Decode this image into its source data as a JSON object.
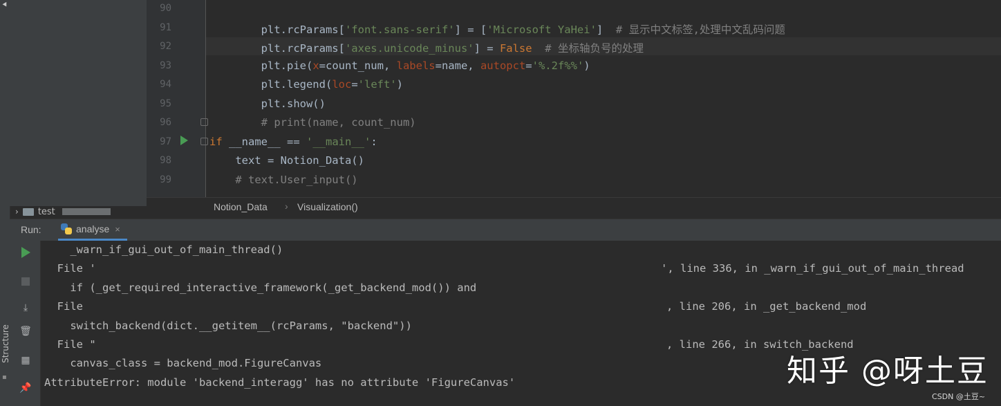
{
  "left_strip": {
    "label": "Structure",
    "top_glyph": "⯇"
  },
  "project": {
    "folder": "test"
  },
  "editor": {
    "lines": [
      {
        "no": "90",
        "segments": []
      },
      {
        "no": "91",
        "segments": [
          {
            "t": "        plt.rcParams[",
            "c": "k-fn"
          },
          {
            "t": "'font.sans-serif'",
            "c": "k-str"
          },
          {
            "t": "] = [",
            "c": "k-fn"
          },
          {
            "t": "'Microsoft YaHei'",
            "c": "k-str"
          },
          {
            "t": "]  ",
            "c": "k-fn"
          },
          {
            "t": "# 显示中文标签,处理中文乱码问题",
            "c": "k-com"
          }
        ]
      },
      {
        "no": "92",
        "segments": [
          {
            "t": "        plt.rcParams[",
            "c": "k-fn"
          },
          {
            "t": "'axes.unicode_minus'",
            "c": "k-str"
          },
          {
            "t": "] = ",
            "c": "k-fn"
          },
          {
            "t": "False",
            "c": "k-kw"
          },
          {
            "t": "  ",
            "c": "k-fn"
          },
          {
            "t": "# 坐标轴负号的处理",
            "c": "k-com"
          }
        ]
      },
      {
        "no": "93",
        "segments": [
          {
            "t": "        plt.pie(",
            "c": "k-fn"
          },
          {
            "t": "x",
            "c": "k-param"
          },
          {
            "t": "=count_num, ",
            "c": "k-fn"
          },
          {
            "t": "labels",
            "c": "k-param"
          },
          {
            "t": "=name, ",
            "c": "k-fn"
          },
          {
            "t": "autopct",
            "c": "k-param"
          },
          {
            "t": "=",
            "c": "k-fn"
          },
          {
            "t": "'%.2f%%'",
            "c": "k-str"
          },
          {
            "t": ")",
            "c": "k-fn"
          }
        ]
      },
      {
        "no": "94",
        "segments": [
          {
            "t": "        plt.legend(",
            "c": "k-fn"
          },
          {
            "t": "loc",
            "c": "k-param"
          },
          {
            "t": "=",
            "c": "k-fn"
          },
          {
            "t": "'left'",
            "c": "k-str"
          },
          {
            "t": ")",
            "c": "k-fn"
          }
        ]
      },
      {
        "no": "95",
        "segments": [
          {
            "t": "        plt.show()",
            "c": "k-fn"
          }
        ]
      },
      {
        "no": "96",
        "segments": [
          {
            "t": "        # print(name, count_num)",
            "c": "k-com"
          }
        ]
      },
      {
        "no": "97",
        "segments": [
          {
            "t": "if",
            "c": "k-kw"
          },
          {
            "t": " __name__ == ",
            "c": "k-fn"
          },
          {
            "t": "'__main__'",
            "c": "k-str"
          },
          {
            "t": ":",
            "c": "k-fn"
          }
        ]
      },
      {
        "no": "98",
        "segments": [
          {
            "t": "    text = Notion_Data()",
            "c": "k-fn"
          }
        ]
      },
      {
        "no": "99",
        "segments": [
          {
            "t": "    # text.User_input()",
            "c": "k-com"
          }
        ]
      }
    ]
  },
  "breadcrumb": {
    "items": [
      "Notion_Data",
      "Visualization()"
    ],
    "separator": "›"
  },
  "run": {
    "label": "Run:",
    "tab_label": "analyse",
    "close_glyph": "×"
  },
  "console": {
    "lines": [
      {
        "text": "    _warn_if_gui_out_of_main_thread()"
      },
      {
        "text": "  File '",
        "tail": "', line 336, in _warn_if_gui_out_of_main_thread"
      },
      {
        "text": "    if (_get_required_interactive_framework(_get_backend_mod()) and"
      },
      {
        "text": "  File",
        "tail": ", line 206, in _get_backend_mod"
      },
      {
        "text": "    switch_backend(dict.__getitem__(rcParams, \"backend\"))"
      },
      {
        "text": "  File \"",
        "tail": ", line 266, in switch_backend"
      },
      {
        "text": "    canvas_class = backend_mod.FigureCanvas"
      },
      {
        "text": "AttributeError: module 'backend_interagg' has no attribute 'FigureCanvas'"
      }
    ]
  },
  "watermark": {
    "text": "知乎 @呀土豆",
    "sub": "CSDN @土豆~"
  },
  "colors": {
    "bg": "#2b2b2b",
    "panel": "#3c3f41",
    "string": "#6a8759",
    "keyword": "#cc7832",
    "param": "#aa4926",
    "comment": "#808080",
    "run_green": "#499c54"
  }
}
